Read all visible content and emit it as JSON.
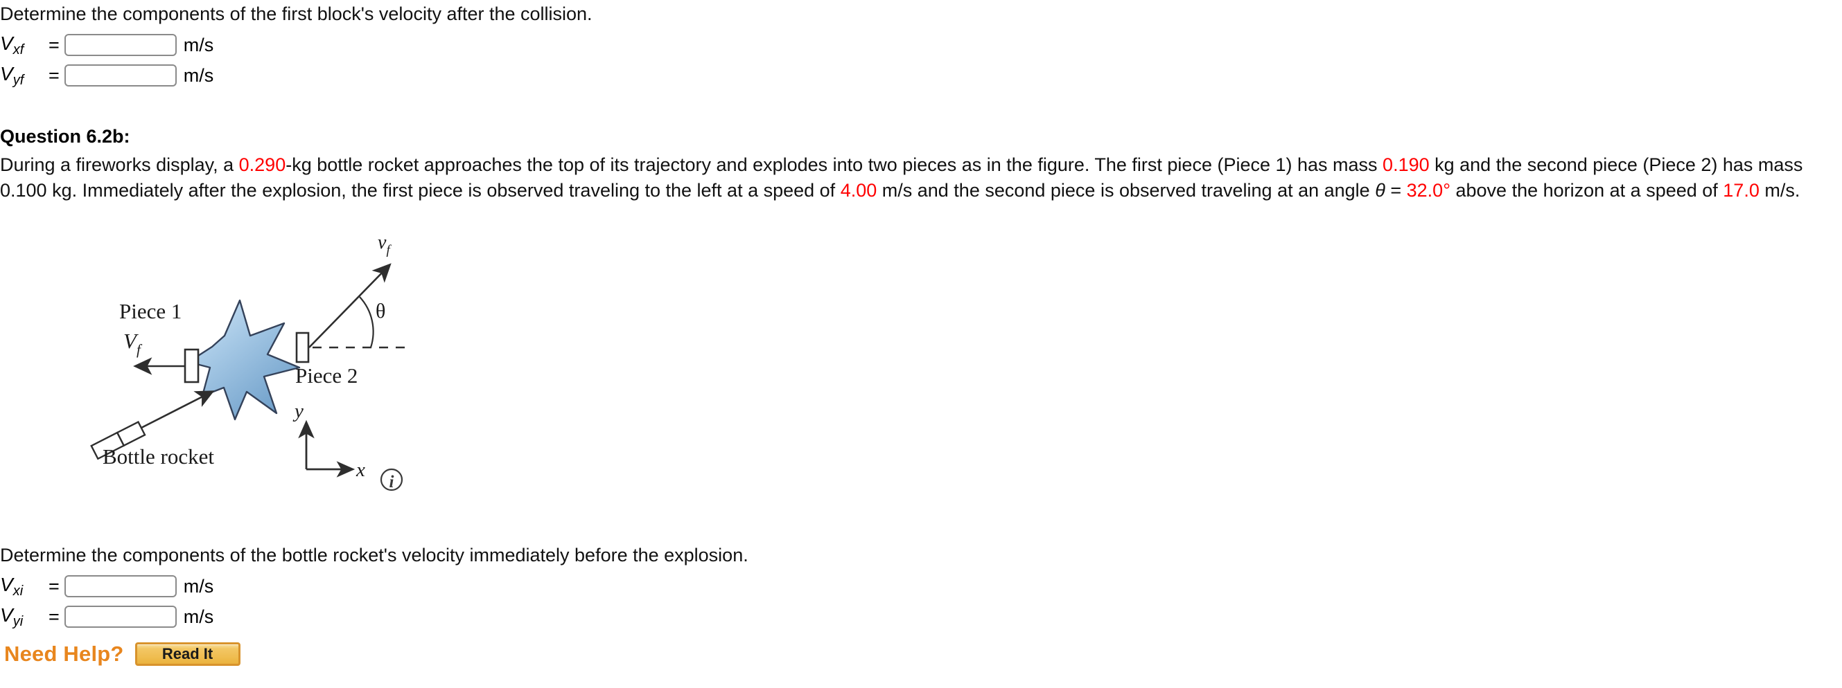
{
  "top_section": {
    "prompt": "Determine the components of the first block's velocity after the collision.",
    "fields": [
      {
        "var_main": "V",
        "var_sub": "xf",
        "equals": "=",
        "value": "",
        "unit": "m/s"
      },
      {
        "var_main": "V",
        "var_sub": "yf",
        "equals": "=",
        "value": "",
        "unit": "m/s"
      }
    ]
  },
  "question": {
    "heading": "Question 6.2b:",
    "text_parts": [
      {
        "t": "During a fireworks display, a ",
        "color": "black"
      },
      {
        "t": "0.290",
        "color": "red"
      },
      {
        "t": "-kg bottle rocket approaches the top of its trajectory and explodes into two pieces as in the figure. The first piece (Piece 1) has mass ",
        "color": "black"
      },
      {
        "t": "0.190",
        "color": "red"
      },
      {
        "t": " kg and the second piece (Piece 2) has mass 0.100 kg. Immediately after the explosion, the first piece is observed traveling to the left at a speed of ",
        "color": "black"
      },
      {
        "t": "4.00",
        "color": "red"
      },
      {
        "t": " m/s and the second piece is observed traveling at an angle ",
        "color": "black"
      },
      {
        "t": "θ",
        "color": "black",
        "italic": true
      },
      {
        "t": " = ",
        "color": "black"
      },
      {
        "t": "32.0°",
        "color": "red"
      },
      {
        "t": " above the horizon at a speed of ",
        "color": "black"
      },
      {
        "t": "17.0",
        "color": "red"
      },
      {
        "t": " m/s.",
        "color": "black"
      }
    ],
    "values": {
      "rocket_mass_kg": "0.290",
      "piece1_mass_kg": "0.190",
      "piece2_mass_kg": "0.100",
      "piece1_speed_mps": "4.00",
      "angle_deg": "32.0°",
      "piece2_speed_mps": "17.0"
    }
  },
  "figure": {
    "labels": {
      "piece1": "Piece 1",
      "piece2": "Piece 2",
      "piece1_velocity": "V",
      "piece1_velocity_sub": "f",
      "piece2_velocity": "v",
      "piece2_velocity_sub": "f",
      "theta": "θ",
      "bottle_rocket": "Bottle rocket",
      "axis_y": "y",
      "axis_x": "x"
    },
    "info_icon": "i",
    "colors": {
      "star_light": "#c8dff2",
      "star_mid": "#9cc3e2",
      "star_dark": "#6d9ec9",
      "stroke": "#2e2e2e"
    }
  },
  "bottom_section": {
    "prompt": "Determine the components of the bottle rocket's velocity immediately before the explosion.",
    "fields": [
      {
        "var_main": "V",
        "var_sub": "xi",
        "equals": "=",
        "value": "",
        "unit": "m/s"
      },
      {
        "var_main": "V",
        "var_sub": "yi",
        "equals": "=",
        "value": "",
        "unit": "m/s"
      }
    ]
  },
  "help": {
    "label": "Need Help?",
    "read_it_button": "Read It"
  }
}
